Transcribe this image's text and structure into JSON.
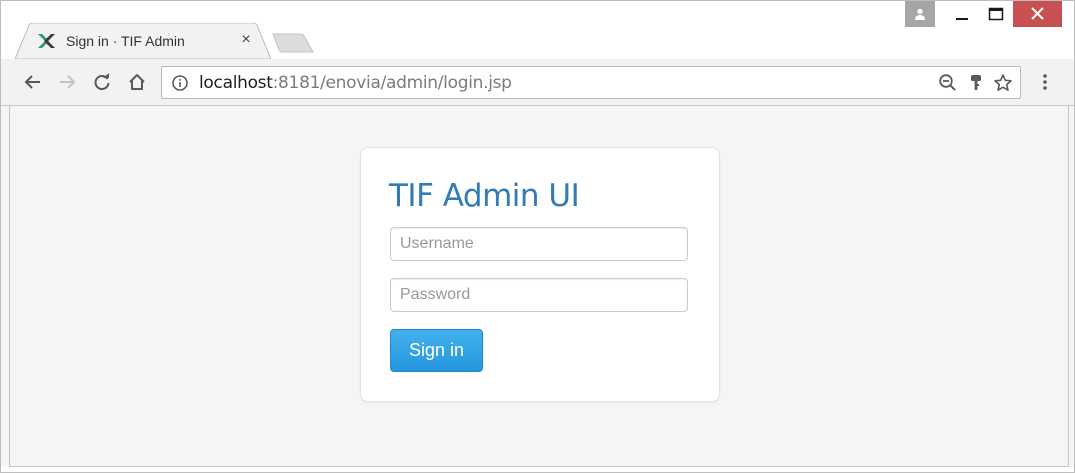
{
  "browser": {
    "tab": {
      "title": "Sign in · TIF Admin",
      "close_glyph": "×",
      "favicon": "tif-logo-icon"
    },
    "address": {
      "host": "localhost",
      "path": ":8181/enovia/admin/login.jsp"
    },
    "icons": {
      "back": "back-arrow-icon",
      "forward": "forward-arrow-icon",
      "reload": "reload-icon",
      "home": "home-icon",
      "info": "info-icon",
      "zoom": "zoom-out-icon",
      "key": "key-icon",
      "star": "bookmark-star-icon",
      "menu": "kebab-menu-icon"
    },
    "window_controls": {
      "close_color": "#c75050",
      "profile_color": "#a6a6a6"
    }
  },
  "login": {
    "heading": "TIF Admin UI",
    "username_placeholder": "Username",
    "password_placeholder": "Password",
    "submit_label": "Sign in"
  },
  "colors": {
    "heading": "#337ab7",
    "button": "#2ea0e6",
    "page_background": "#f5f5f5"
  }
}
